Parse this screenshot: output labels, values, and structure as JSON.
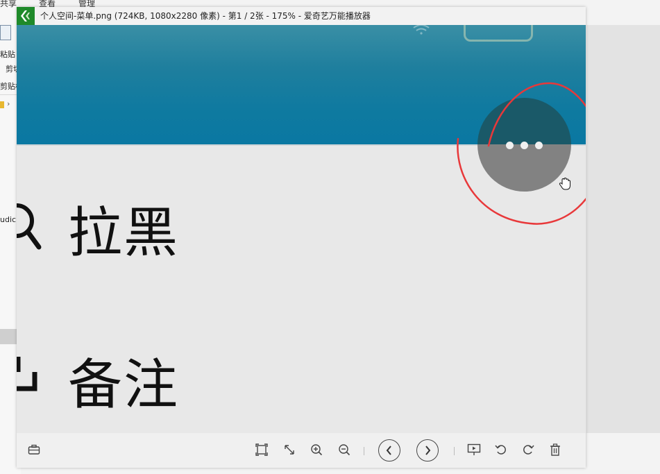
{
  "window": {
    "title": "个人空间-菜单.png (724KB, 1080x2280 像素) - 第1 / 2张 - 175% - 爱奇艺万能播放器"
  },
  "background_explorer": {
    "ribbon_tabs": [
      "共享",
      "查看",
      "管理"
    ],
    "side_labels": [
      "粘贴",
      "剪切",
      "剪贴板",
      "udic"
    ]
  },
  "image": {
    "menu_items": [
      {
        "label": "拉黑",
        "icon": "search-block-icon"
      },
      {
        "label": "备注",
        "icon": "note-icon"
      }
    ],
    "more_button": {
      "icon": "more-dots-icon"
    },
    "annotation": {
      "color": "#e8383a"
    }
  },
  "toolbar": {
    "buttons": [
      "toolbox-icon",
      "fit-window-icon",
      "actual-size-icon",
      "zoom-in-icon",
      "zoom-out-icon",
      "previous-icon",
      "next-icon",
      "slideshow-icon",
      "rotate-left-icon",
      "rotate-right-icon",
      "delete-icon"
    ]
  },
  "colors": {
    "teal": "#0f7aa0",
    "menu_bg": "#e8e8e8",
    "more_top": "#1a5968",
    "more_bottom": "#828282",
    "app_icon": "#1f8a2a"
  }
}
